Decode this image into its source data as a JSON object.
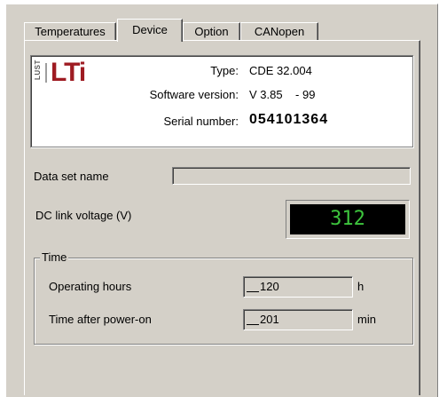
{
  "tabs": [
    {
      "label": "Temperatures",
      "active": false
    },
    {
      "label": "Device",
      "active": true
    },
    {
      "label": "Option",
      "active": false
    },
    {
      "label": "CANopen",
      "active": false
    }
  ],
  "device_info": {
    "logo_small": "LUST",
    "logo_main": "LTi",
    "type_label": "Type:",
    "type_value": "CDE 32.004",
    "software_label": "Software version:",
    "software_value": "V 3.85    - 99",
    "serial_label": "Serial number:",
    "serial_value": "054101364"
  },
  "data_set": {
    "label": "Data set name",
    "value": ""
  },
  "dc_link": {
    "label": "DC link voltage (V)",
    "value": "312"
  },
  "time_group": {
    "title": "Time",
    "operating_hours_label": "Operating hours",
    "operating_hours_value": "120",
    "operating_hours_unit": "h",
    "power_on_label": "Time after power-on",
    "power_on_value": "201",
    "power_on_unit": "min"
  },
  "colors": {
    "window_bg": "#d4d0c8",
    "logo_red": "#9e1b22",
    "display_bg": "#000000",
    "display_text": "#3dc43d"
  }
}
